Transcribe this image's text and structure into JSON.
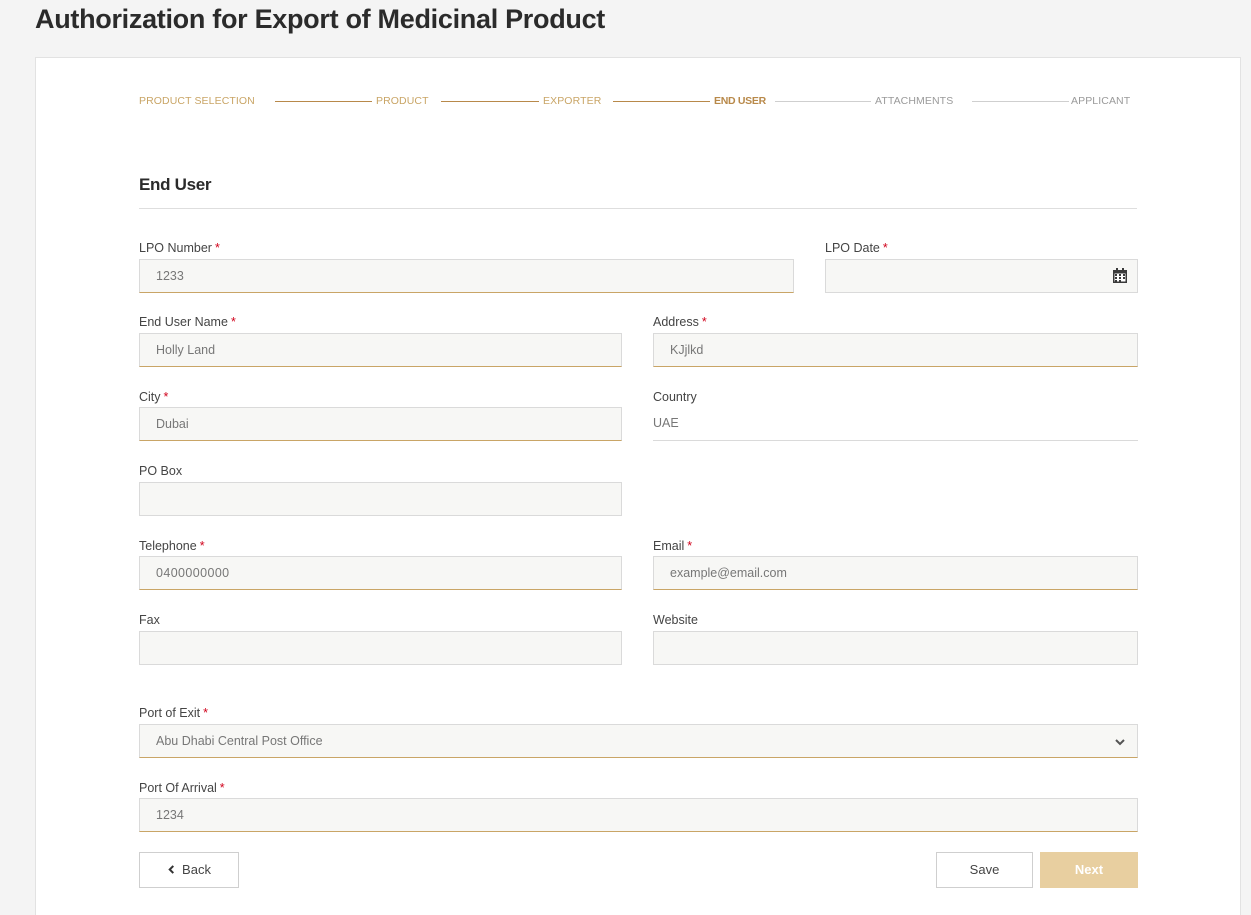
{
  "page": {
    "title": "Authorization for Export of Medicinal Product"
  },
  "stepper": {
    "steps": [
      {
        "label": "PRODUCT SELECTION",
        "state": "done"
      },
      {
        "label": "PRODUCT",
        "state": "done"
      },
      {
        "label": "EXPORTER",
        "state": "done"
      },
      {
        "label": "END USER",
        "state": "active"
      },
      {
        "label": "ATTACHMENTS",
        "state": "future"
      },
      {
        "label": "APPLICANT",
        "state": "future"
      }
    ]
  },
  "section": {
    "title": "End User"
  },
  "form": {
    "required_mark": "*",
    "lpo_number": {
      "label": "LPO Number",
      "value": "1233"
    },
    "lpo_date": {
      "label": "LPO Date",
      "value": ""
    },
    "end_user_name": {
      "label": "End User Name",
      "value": "Holly Land"
    },
    "address": {
      "label": "Address",
      "value": "KJjlkd"
    },
    "city": {
      "label": "City",
      "value": "Dubai"
    },
    "country": {
      "label": "Country",
      "value": "UAE"
    },
    "po_box": {
      "label": "PO Box",
      "value": ""
    },
    "telephone": {
      "label": "Telephone",
      "value": "0400000000"
    },
    "email": {
      "label": "Email",
      "value": "example@email.com"
    },
    "fax": {
      "label": "Fax",
      "value": ""
    },
    "website": {
      "label": "Website",
      "value": ""
    },
    "port_of_exit": {
      "label": "Port of Exit",
      "value": "Abu Dhabi Central Post Office"
    },
    "port_of_arrival": {
      "label": "Port Of Arrival",
      "value": "1234"
    }
  },
  "buttons": {
    "back": "Back",
    "save": "Save",
    "next": "Next"
  },
  "icons": {
    "calendar": "calendar-icon",
    "chevron": "chevron-down-icon",
    "back": "chevron-left-icon"
  },
  "colors": {
    "accent": "#c9a566",
    "required": "#d0021b",
    "next_button": "#e8cfa0"
  }
}
